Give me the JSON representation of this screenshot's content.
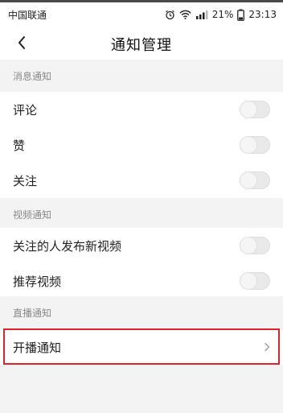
{
  "status_bar": {
    "carrier": "中国联通",
    "battery": "21%",
    "time": "23:13",
    "icons": [
      "alarm-icon",
      "wifi-icon",
      "signal-icon",
      "battery-icon"
    ]
  },
  "header": {
    "back_icon": "chevron-left-icon",
    "title": "通知管理"
  },
  "sections": {
    "message": {
      "title": "消息通知",
      "items": [
        {
          "label": "评论",
          "enabled": false
        },
        {
          "label": "赞",
          "enabled": false
        },
        {
          "label": "关注",
          "enabled": false
        }
      ]
    },
    "video": {
      "title": "视频通知",
      "items": [
        {
          "label": "关注的人发布新视频",
          "enabled": false
        },
        {
          "label": "推荐视频",
          "enabled": false
        }
      ]
    },
    "live": {
      "title": "直播通知",
      "items": [
        {
          "label": "开播通知",
          "icon": "chevron-right-icon"
        }
      ]
    }
  },
  "colors": {
    "highlight": "#e0222a",
    "background": "#f3f3f3",
    "toggle_off": "#e9e9e9"
  }
}
